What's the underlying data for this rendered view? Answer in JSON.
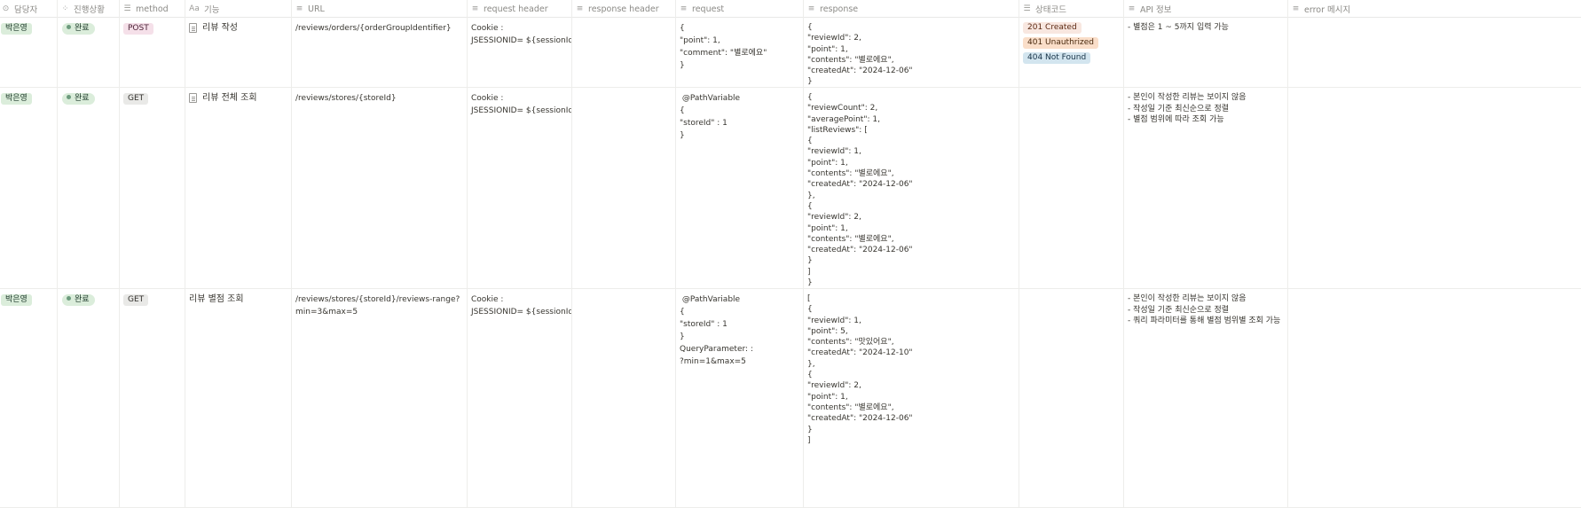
{
  "headers": [
    {
      "label": "담당자",
      "icon": "person-circle-icon"
    },
    {
      "label": "진행상황",
      "icon": "status-spinner-icon"
    },
    {
      "label": "method",
      "icon": "list-icon"
    },
    {
      "label": "기능",
      "icon": "text-aa-icon",
      "icon_text": "Aa"
    },
    {
      "label": "URL",
      "icon": "text-lines-icon"
    },
    {
      "label": "request header",
      "icon": "text-lines-icon"
    },
    {
      "label": "response header",
      "icon": "text-lines-icon"
    },
    {
      "label": "request",
      "icon": "text-lines-icon"
    },
    {
      "label": "response",
      "icon": "text-lines-icon"
    },
    {
      "label": "상태코드",
      "icon": "list-icon"
    },
    {
      "label": "API 정보",
      "icon": "text-lines-icon"
    },
    {
      "label": "error 메시지",
      "icon": "text-lines-icon"
    }
  ],
  "rows": [
    {
      "assignee": "박은영",
      "status": "완료",
      "method": "POST",
      "feature": "리뷰 작성",
      "url": [
        "/reviews/orders/{orderGroupIdentifier}"
      ],
      "request_header": [
        "Cookie :",
        "JSESSIONID= ${sessionId}"
      ],
      "response_header": [],
      "request": [
        "{",
        "\"point\": 1,",
        "\"comment\": \"별로에요\"",
        "}"
      ],
      "response": [
        "{",
        "\"reviewId\": 2,",
        "\"point\": 1,",
        "\"contents\": \"별로에요\",",
        "\"createdAt\": \"2024-12-06\"",
        "}"
      ],
      "status_codes": [
        {
          "label": "201 Created",
          "color": "#f8e7e0"
        },
        {
          "label": "401 Unauthrized",
          "color": "#fadec9"
        },
        {
          "label": "404 Not Found",
          "color": "#d3e5ef"
        }
      ],
      "api_info": [
        "- 별점은 1 ~ 5까지 입력 가능"
      ],
      "error": []
    },
    {
      "assignee": "박은영",
      "status": "완료",
      "method": "GET",
      "feature": "리뷰 전체 조회",
      "url": [
        "/reviews/stores/{storeId}"
      ],
      "request_header": [
        "Cookie :",
        "JSESSIONID= ${sessionId}"
      ],
      "response_header": [],
      "request": [
        " @PathVariable",
        "{",
        "\"storeId\" : 1",
        "}"
      ],
      "response": [
        "{",
        "\"reviewCount\": 2,",
        "\"averagePoint\": 1,",
        "\"listReviews\": [",
        "{",
        "\"reviewId\": 1,",
        "\"point\": 1,",
        "\"contents\": \"별로에요\",",
        "\"createdAt\": \"2024-12-06\"",
        "},",
        "{",
        "\"reviewId\": 2,",
        "\"point\": 1,",
        "\"contents\": \"별로에요\",",
        "\"createdAt\": \"2024-12-06\"",
        "}",
        "]",
        "}"
      ],
      "status_codes": [],
      "api_info": [
        "- 본인이 작성한 리뷰는 보이지 않음",
        "- 작성일 기준 최신순으로 정렬",
        "- 별점 범위에 따라 조회 가능"
      ],
      "error": []
    },
    {
      "assignee": "박은영",
      "status": "완료",
      "method": "GET",
      "feature": "리뷰 별점 조회",
      "url": [
        "/reviews/stores/{storeId}/reviews-range?",
        "min=3&max=5"
      ],
      "request_header": [
        "Cookie :",
        "JSESSIONID= ${sessionId}"
      ],
      "response_header": [],
      "request": [
        " @PathVariable",
        "{",
        "\"storeId\" : 1",
        "}",
        "QueryParameter: :",
        "?min=1&max=5"
      ],
      "response": [
        "[",
        "{",
        "\"reviewId\": 1,",
        "\"point\": 5,",
        "\"contents\": \"맛있어요\",",
        "\"createdAt\": \"2024-12-10\"",
        "},",
        "{",
        "\"reviewId\": 2,",
        "\"point\": 1,",
        "\"contents\": \"별로에요\",",
        "\"createdAt\": \"2024-12-06\"",
        "}",
        "]"
      ],
      "status_codes": [],
      "api_info": [
        "- 본인이 작성한 리뷰는 보이지 않음",
        "- 작성일 기준 최신순으로 정렬",
        "- 쿼리 파라미터를 통해 별점 범위별 조회 가능"
      ],
      "error": []
    }
  ],
  "colors": {
    "assignee_tag": "#dbeddb",
    "status_tag": "#dbeddb",
    "post_tag": "#f5e0e9",
    "get_tag": "#e9e9e7"
  }
}
